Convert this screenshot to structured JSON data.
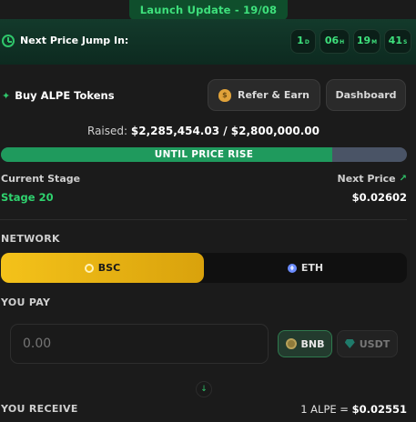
{
  "banner": {
    "text": "Launch Update - 19/08"
  },
  "countdown": {
    "label": "Next Price Jump In:",
    "days": "1",
    "days_unit": "D",
    "hours": "06",
    "hours_unit": "H",
    "minutes": "19",
    "minutes_unit": "M",
    "seconds": "41",
    "seconds_unit": "S"
  },
  "header": {
    "title": "Buy ALPE Tokens",
    "refer_label": "Refer & Earn",
    "dashboard_label": "Dashboard"
  },
  "raised": {
    "prefix": "Raised:",
    "amount": "$2,285,454.03 / $2,800,000.00"
  },
  "progress": {
    "label": "UNTIL PRICE RISE",
    "fraction": 0.8162
  },
  "stage": {
    "current_label": "Current Stage",
    "current_value": "Stage 20",
    "next_label": "Next Price",
    "next_value": "$0.02602"
  },
  "network": {
    "label": "NETWORK",
    "options": [
      {
        "label": "BSC",
        "selected": true
      },
      {
        "label": "ETH",
        "selected": false
      }
    ]
  },
  "pay": {
    "label": "YOU PAY",
    "placeholder": "0.00",
    "currencies": [
      {
        "label": "BNB",
        "selected": true
      },
      {
        "label": "USDT",
        "selected": false
      }
    ]
  },
  "receive": {
    "label": "YOU RECEIVE",
    "rate_prefix": "1 ALPE = ",
    "rate_value": "$0.02551"
  },
  "colors": {
    "accent_green": "#2fd36f",
    "bsc_yellow": "#f4c21a",
    "progress_fill": "#1f9a5d",
    "progress_track": "#4a5466"
  }
}
